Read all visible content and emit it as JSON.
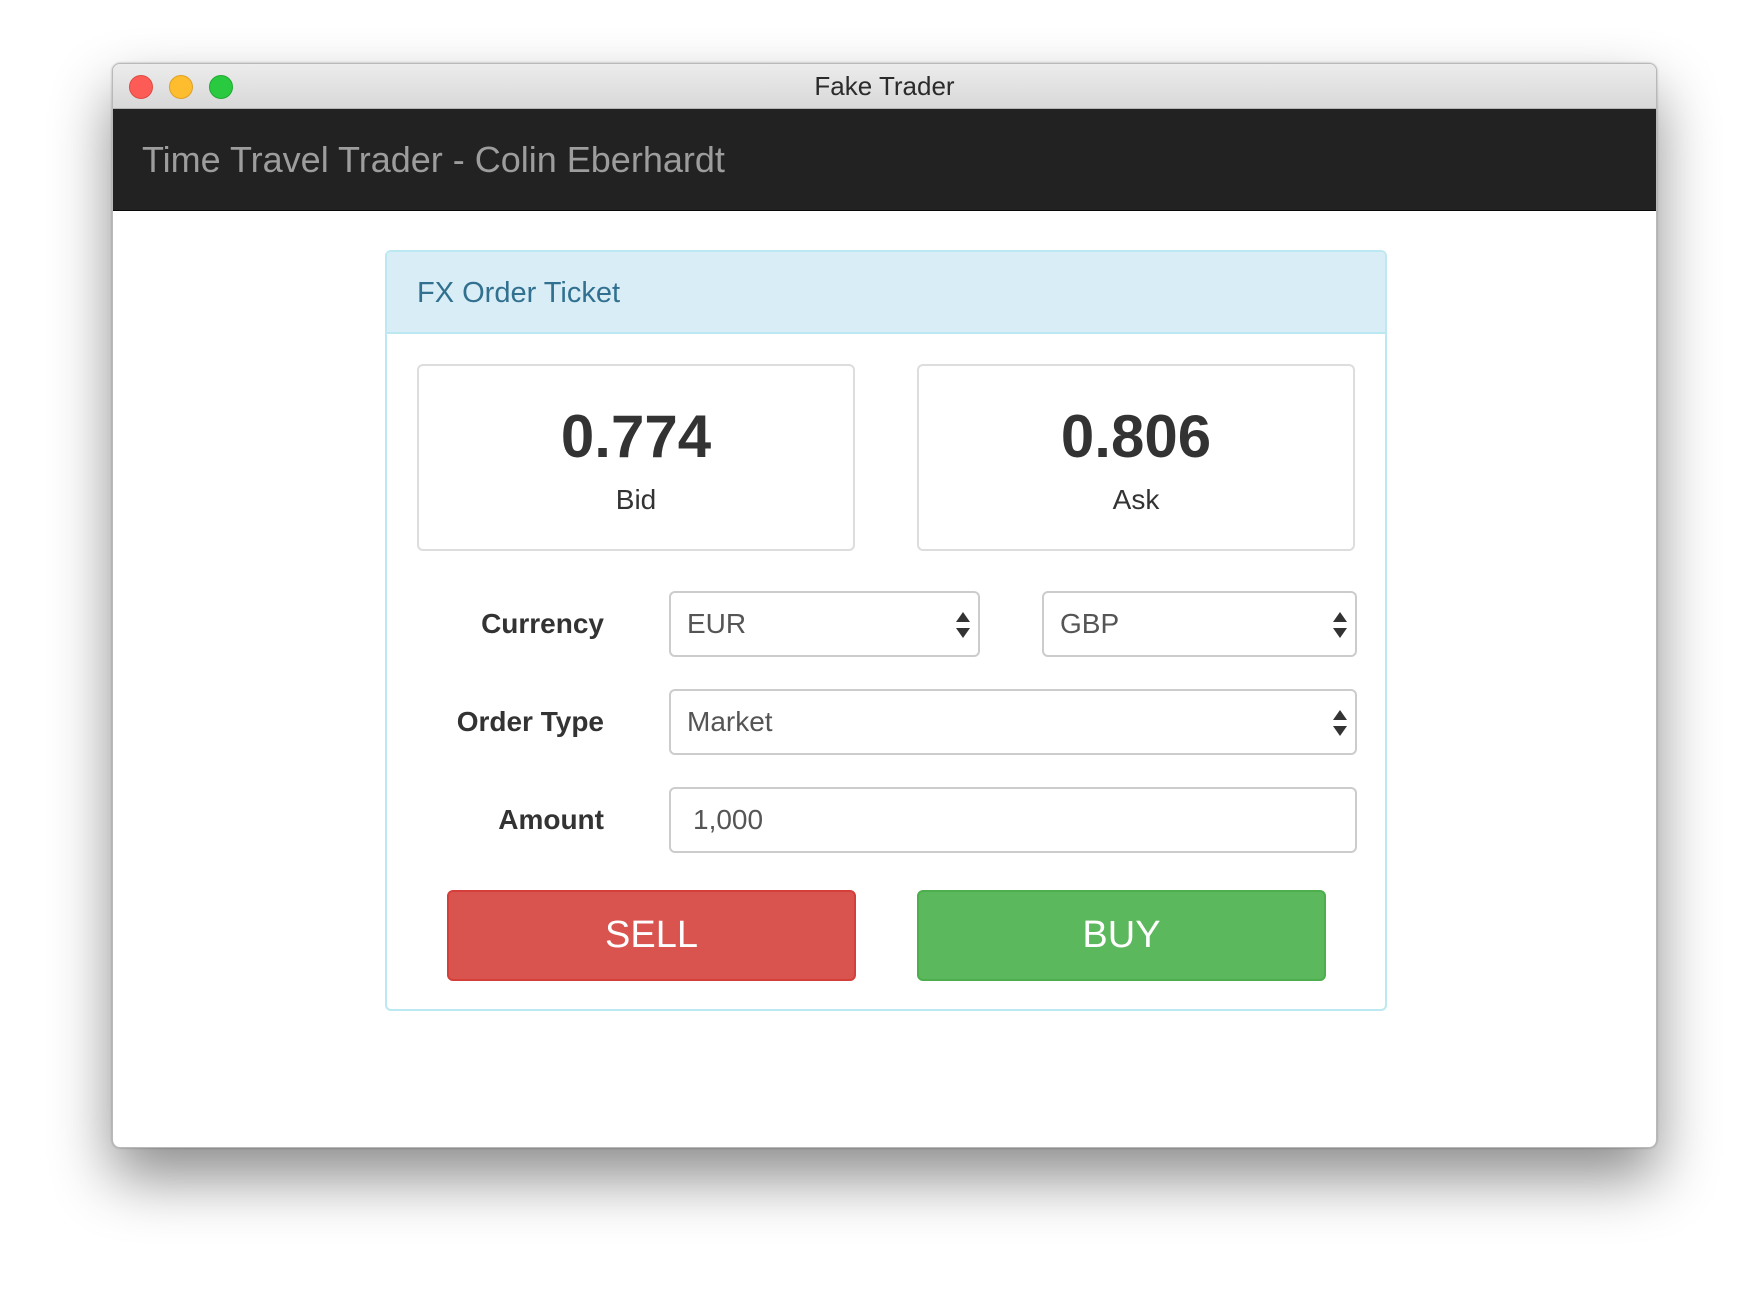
{
  "window": {
    "title": "Fake Trader"
  },
  "navbar": {
    "brand": "Time Travel Trader - Colin Eberhardt"
  },
  "panel": {
    "title": "FX Order Ticket"
  },
  "prices": {
    "bid": {
      "value": "0.774",
      "label": "Bid"
    },
    "ask": {
      "value": "0.806",
      "label": "Ask"
    }
  },
  "form": {
    "currency": {
      "label": "Currency",
      "from_value": "EUR",
      "to_value": "GBP"
    },
    "order_type": {
      "label": "Order Type",
      "value": "Market"
    },
    "amount": {
      "label": "Amount",
      "value": "1,000"
    }
  },
  "buttons": {
    "sell_label": "SELL",
    "buy_label": "BUY"
  },
  "colors": {
    "navbar_bg": "#222222",
    "panel_heading_bg": "#d9edf7",
    "panel_border": "#bce8f1",
    "sell": "#d9534f",
    "buy": "#5cb85c"
  },
  "icons": {
    "select_arrows": "up-down-arrows-icon"
  }
}
